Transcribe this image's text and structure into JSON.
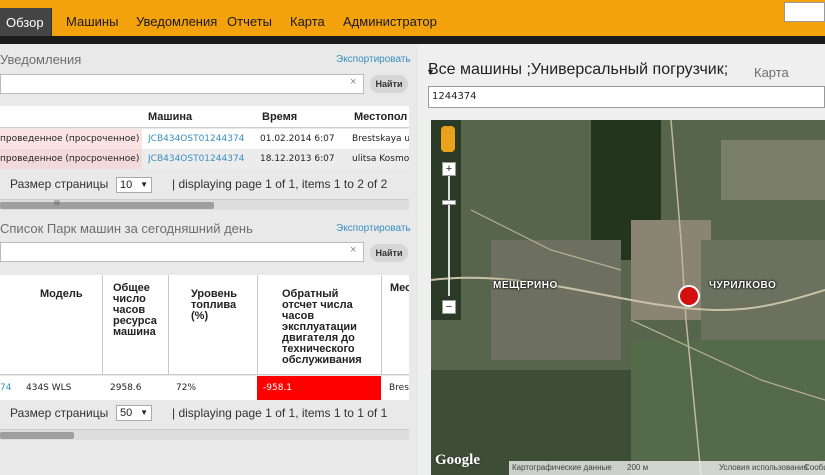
{
  "nav": {
    "items": [
      "Обзор",
      "Машины",
      "Уведомления",
      "Отчеты",
      "Карта",
      "Администратор"
    ],
    "active": "Обзор"
  },
  "notifications": {
    "title": "Уведомления",
    "export": "Экспортировать",
    "search_clear": "×",
    "find": "Найти",
    "columns": [
      "Машина",
      "Время",
      "Местопол"
    ],
    "rows": [
      {
        "status": "проведенное (просроченное)",
        "machine": "JCB434OST01244374",
        "time": "01.02.2014 6:07",
        "location": "Brestskaya ulit"
      },
      {
        "status": "проведенное (просроченное)",
        "machine": "JCB434OST01244374",
        "time": "18.12.2013 6:07",
        "location": "ulitsa Kosmo"
      }
    ],
    "page_size_label": "Размер страницы",
    "page_size": "10",
    "page_info": "| displaying page 1 of 1, items 1 to 2 of 2",
    "scroll_mark": "III"
  },
  "fleet": {
    "title": "Список Парк машин за сегодняшний день",
    "export": "Экспортировать",
    "search_clear": "×",
    "find": "Найти",
    "columns": [
      "Модель",
      "Общее число часов ресурса машина",
      "Уровень топлива (%)",
      "Обратный отсчет числа часов эксплуатации двигателя до технического обслуживания",
      "Мес"
    ],
    "row": {
      "id": "74",
      "model": "434S WLS",
      "hours": "2958.6",
      "fuel": "72%",
      "countdown": "-958.1",
      "location": "Bres"
    },
    "page_size_label": "Размер страницы",
    "page_size": "50",
    "page_info": "| displaying page 1 of 1, items 1 to 1 of 1"
  },
  "machines": {
    "title": "Все машины ;Универсальный погрузчик;",
    "map_link": "Карта",
    "input_value": "1244374"
  },
  "map": {
    "label_left": "МЕЩЕРИНО",
    "label_right": "ЧУРИЛКОВО",
    "google": "Google",
    "attribution": "Картографические данные",
    "scale": "200 м",
    "terms": "Условия использования",
    "report": "Сообщ"
  },
  "colors": {
    "nav": "#f4a20c",
    "overdue_row": "#fbe3e3",
    "alert": "#ff0000",
    "link": "#3b8ec0",
    "marker": "#d40f0f"
  }
}
